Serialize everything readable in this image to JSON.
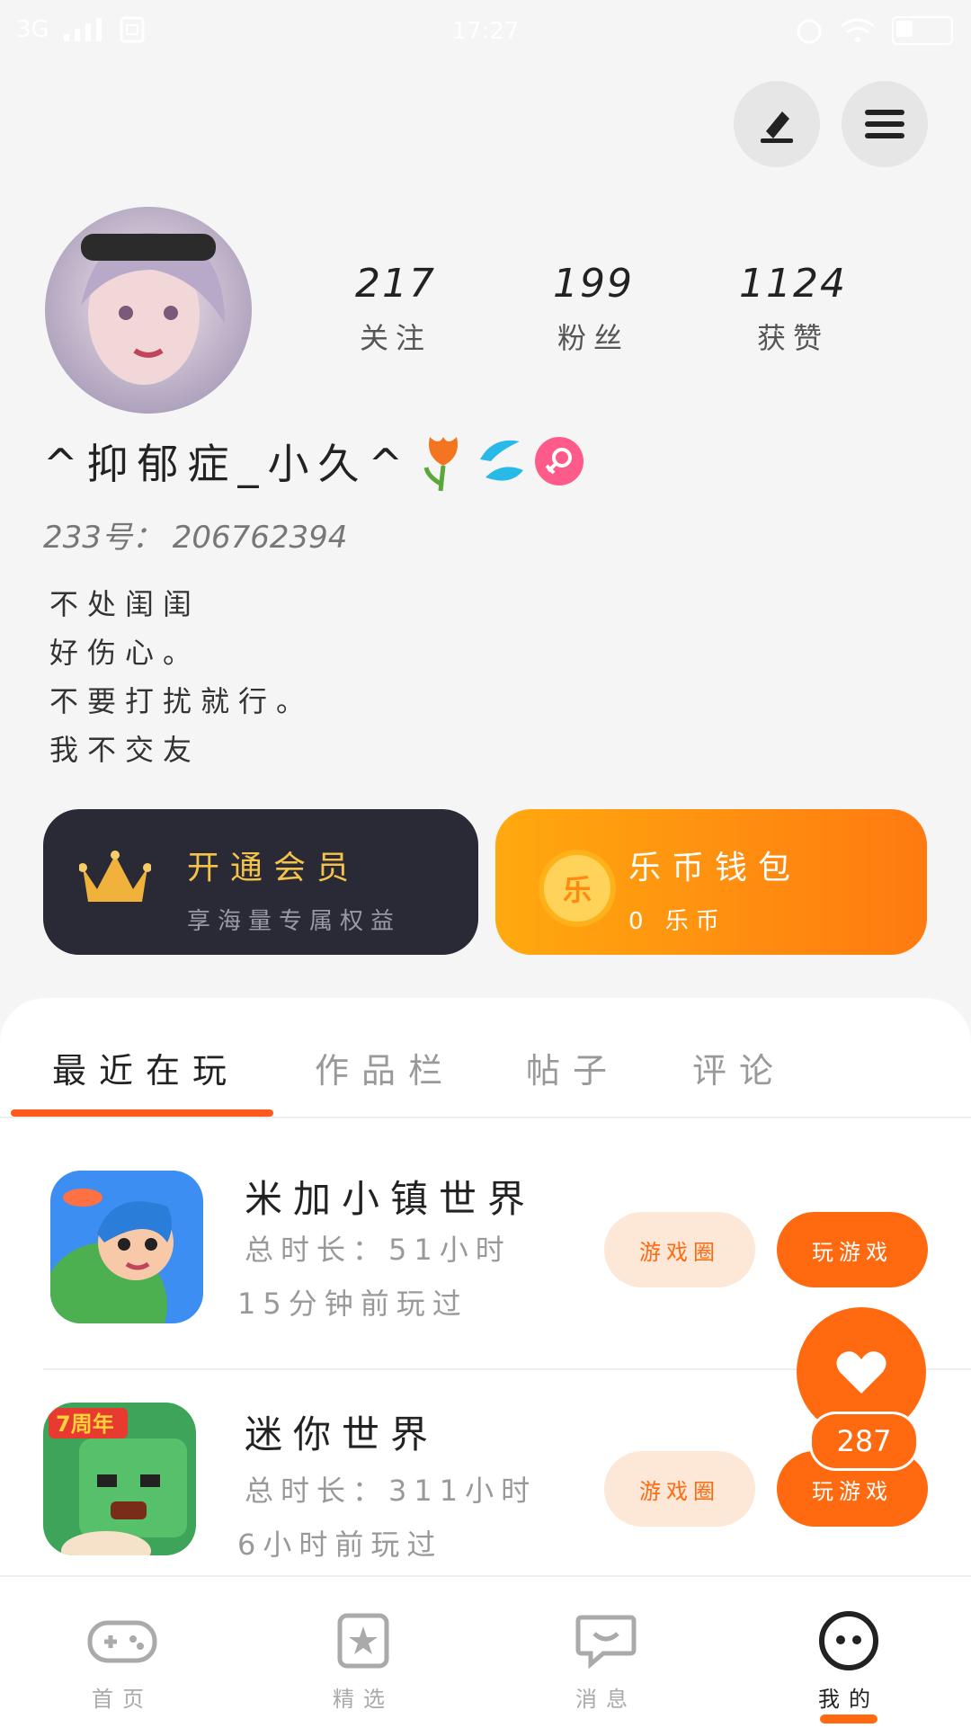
{
  "status_bar": {
    "network": "3G",
    "time": "17:27"
  },
  "profile": {
    "stats": [
      {
        "value": "217",
        "label": "关注"
      },
      {
        "value": "199",
        "label": "粉丝"
      },
      {
        "value": "1124",
        "label": "获赞"
      }
    ],
    "name": "^抑郁症_小久^",
    "uid": "233号： 206762394",
    "bio_lines": [
      "不处闺闺",
      "好伤心。",
      "不要打扰就行。",
      "我不交友"
    ]
  },
  "cards": {
    "vip_title": "开通会员",
    "vip_sub": "享海量专属权益",
    "wallet_title": "乐币钱包",
    "wallet_sub": "0 乐币",
    "wallet_coin": "乐"
  },
  "tabs": [
    "最近在玩",
    "作品栏",
    "帖子",
    "评论"
  ],
  "games": [
    {
      "title": "米加小镇世界",
      "total": "总时长：51小时",
      "last": "15分钟前玩过",
      "circle_btn": "游戏圈",
      "play_btn": "玩游戏"
    },
    {
      "title": "迷你世界",
      "total": "总时长：311小时",
      "last": "6小时前玩过",
      "circle_btn": "游戏圈",
      "play_btn": "玩游戏",
      "icon_text": "7周年"
    }
  ],
  "like_count": "287",
  "nav": [
    {
      "label": "首页"
    },
    {
      "label": "精选"
    },
    {
      "label": "消息"
    },
    {
      "label": "我的"
    }
  ],
  "colors": {
    "accent": "#ff6a10",
    "vip_bg": "#2a2a36",
    "vip_text": "#f5c34a"
  }
}
